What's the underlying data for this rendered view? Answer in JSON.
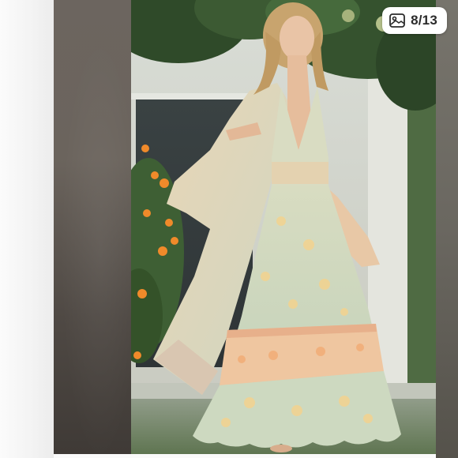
{
  "viewer": {
    "counter_text": "8/13",
    "counter_icon": "photo-gallery-icon"
  },
  "colors": {
    "dress_green": "#c9d8c0",
    "dress_peach": "#f0c79f",
    "foliage": "#3f5a33",
    "flowers": "#f08a2a"
  }
}
